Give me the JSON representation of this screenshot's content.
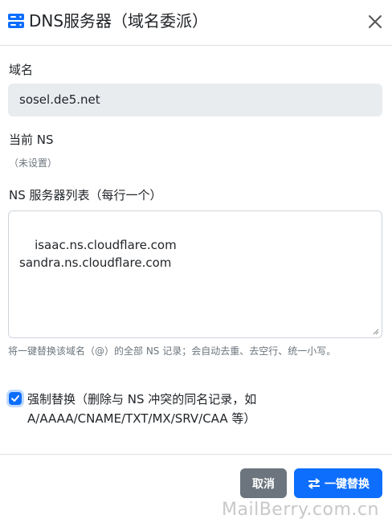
{
  "header": {
    "title": "DNS服务器（域名委派）",
    "title_icon": "server-icon",
    "close_icon": "close-icon"
  },
  "form": {
    "domain_label": "域名",
    "domain_value": "sosel.de5.net",
    "current_ns_label": "当前 NS",
    "current_ns_value": "（未设置）",
    "ns_list_label": "NS 服务器列表（每行一个）",
    "ns_list_value": "isaac.ns.cloudflare.com\nsandra.ns.cloudflare.com",
    "help_text": "将一键替换该域名（@）的全部 NS 记录；会自动去重、去空行、统一小写。",
    "force_replace_checked": true,
    "force_replace_label": "强制替换（删除与 NS 冲突的同名记录，如 A/AAAA/CNAME/TXT/MX/SRV/CAA 等）"
  },
  "footer": {
    "cancel_label": "取消",
    "replace_label": "一键替换",
    "replace_icon": "swap-arrows-icon"
  },
  "watermark": "MailBerry.com.cn",
  "colors": {
    "primary": "#0d6efd",
    "secondary": "#6c757d",
    "input_disabled_bg": "#e9ecef",
    "muted_text": "#6c757d"
  }
}
